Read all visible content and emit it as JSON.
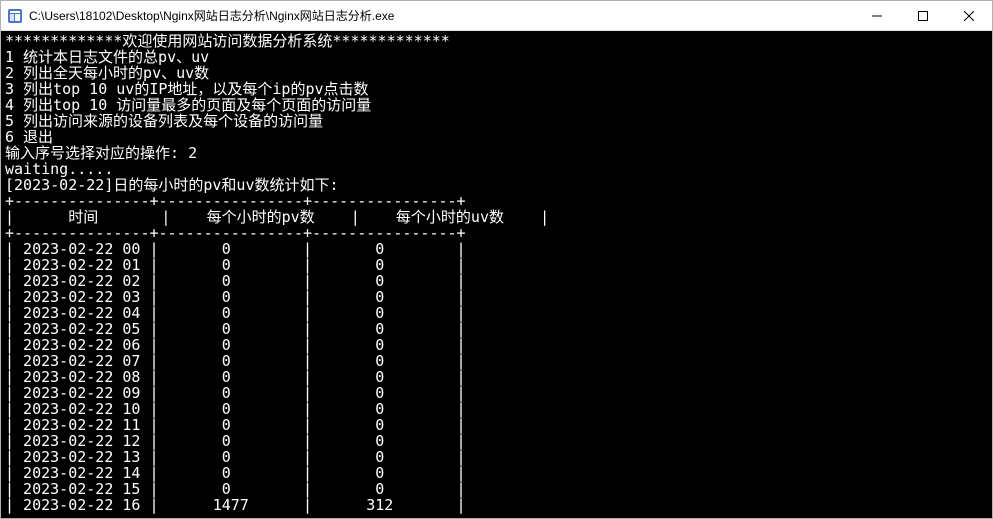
{
  "titlebar": {
    "path": "C:\\Users\\18102\\Desktop\\Nginx网站日志分析\\Nginx网站日志分析.exe"
  },
  "console": {
    "banner_stars_left": "*************",
    "banner_text": "欢迎使用网站访问数据分析系统",
    "banner_stars_right": "*************",
    "menu": [
      {
        "num": "1",
        "text": "统计本日志文件的总pv、uv"
      },
      {
        "num": "2",
        "text": "列出全天每小时的pv、uv数"
      },
      {
        "num": "3",
        "text": "列出top 10 uv的IP地址，以及每个ip的pv点击数"
      },
      {
        "num": "4",
        "text": "列出top 10 访问量最多的页面及每个页面的访问量"
      },
      {
        "num": "5",
        "text": "列出访问来源的设备列表及每个设备的访问量"
      },
      {
        "num": "6",
        "text": "退出"
      }
    ],
    "prompt": "输入序号选择对应的操作: ",
    "input_value": "2",
    "waiting": "waiting.....",
    "result_header": "[2023-02-22]日的每小时的pv和uv数统计如下:",
    "table": {
      "col1": "时间",
      "col2": "每个小时的pv数",
      "col3": "每个小时的uv数",
      "rows": [
        {
          "time": "2023-02-22 00",
          "pv": "0",
          "uv": "0"
        },
        {
          "time": "2023-02-22 01",
          "pv": "0",
          "uv": "0"
        },
        {
          "time": "2023-02-22 02",
          "pv": "0",
          "uv": "0"
        },
        {
          "time": "2023-02-22 03",
          "pv": "0",
          "uv": "0"
        },
        {
          "time": "2023-02-22 04",
          "pv": "0",
          "uv": "0"
        },
        {
          "time": "2023-02-22 05",
          "pv": "0",
          "uv": "0"
        },
        {
          "time": "2023-02-22 06",
          "pv": "0",
          "uv": "0"
        },
        {
          "time": "2023-02-22 07",
          "pv": "0",
          "uv": "0"
        },
        {
          "time": "2023-02-22 08",
          "pv": "0",
          "uv": "0"
        },
        {
          "time": "2023-02-22 09",
          "pv": "0",
          "uv": "0"
        },
        {
          "time": "2023-02-22 10",
          "pv": "0",
          "uv": "0"
        },
        {
          "time": "2023-02-22 11",
          "pv": "0",
          "uv": "0"
        },
        {
          "time": "2023-02-22 12",
          "pv": "0",
          "uv": "0"
        },
        {
          "time": "2023-02-22 13",
          "pv": "0",
          "uv": "0"
        },
        {
          "time": "2023-02-22 14",
          "pv": "0",
          "uv": "0"
        },
        {
          "time": "2023-02-22 15",
          "pv": "0",
          "uv": "0"
        },
        {
          "time": "2023-02-22 16",
          "pv": "1477",
          "uv": "312"
        }
      ]
    }
  }
}
